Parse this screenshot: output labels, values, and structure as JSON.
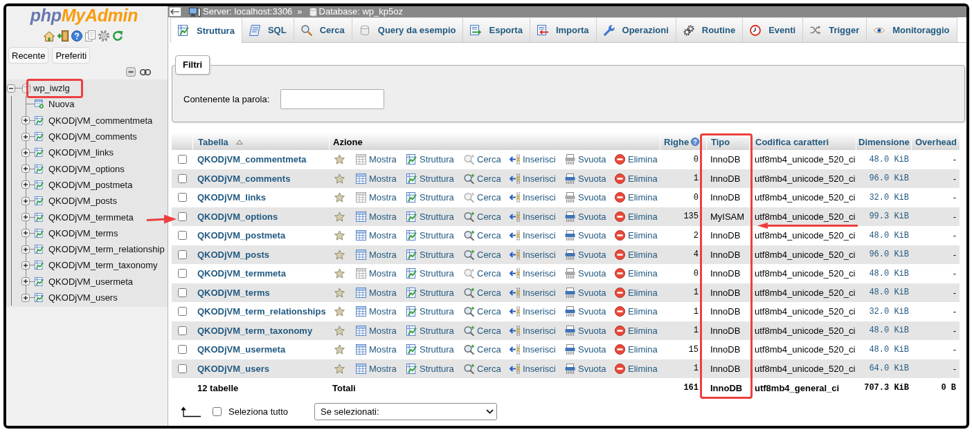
{
  "navigation": {
    "logo": {
      "parts": [
        "php",
        "MyAdmin"
      ]
    },
    "buttons": [
      "Recente",
      "Preferiti"
    ],
    "tree": [
      {
        "label": "wp_iwzlg",
        "kind": "database",
        "expanded": true,
        "children": [
          {
            "label": "Nuova",
            "kind": "new"
          },
          {
            "label": "QKODjVM_commentmeta",
            "kind": "table",
            "expanded": false
          },
          {
            "label": "QKODjVM_comments",
            "kind": "table",
            "expanded": false
          },
          {
            "label": "QKODjVM_links",
            "kind": "table",
            "expanded": false
          },
          {
            "label": "QKODjVM_options",
            "kind": "table",
            "expanded": false
          },
          {
            "label": "QKODjVM_postmeta",
            "kind": "table",
            "expanded": false
          },
          {
            "label": "QKODjVM_posts",
            "kind": "table",
            "expanded": false
          },
          {
            "label": "QKODjVM_termmeta",
            "kind": "table",
            "expanded": false
          },
          {
            "label": "QKODjVM_terms",
            "kind": "table",
            "expanded": false
          },
          {
            "label": "QKODjVM_term_relationship",
            "kind": "table",
            "expanded": false
          },
          {
            "label": "QKODjVM_term_taxonomy",
            "kind": "table",
            "expanded": false
          },
          {
            "label": "QKODjVM_usermeta",
            "kind": "table",
            "expanded": false
          },
          {
            "label": "QKODjVM_users",
            "kind": "table",
            "expanded": false
          }
        ]
      }
    ]
  },
  "breadcrumb": {
    "server": "Server: localhost:3306",
    "separator": "»",
    "database": "Database: wp_kp5oz"
  },
  "tabs": [
    {
      "label": "Struttura",
      "selected": true
    },
    {
      "label": "SQL",
      "selected": false
    },
    {
      "label": "Cerca",
      "selected": false
    },
    {
      "label": "Query da esempio",
      "selected": false
    },
    {
      "label": "Esporta",
      "selected": false
    },
    {
      "label": "Importa",
      "selected": false
    },
    {
      "label": "Operazioni",
      "selected": false
    },
    {
      "label": "Routine",
      "selected": false
    },
    {
      "label": "Eventi",
      "selected": false
    },
    {
      "label": "Trigger",
      "selected": false
    },
    {
      "label": "Monitoraggio",
      "selected": false
    }
  ],
  "filters": {
    "legend": "Filtri",
    "label": "Contenente la parola:"
  },
  "table": {
    "columns": [
      {
        "label": "Tabella",
        "kind": "sorted"
      },
      {
        "label": "Azione",
        "kind": "plain"
      },
      {
        "label": "Righe",
        "kind": "help"
      },
      {
        "label": "Tipo",
        "kind": "link"
      },
      {
        "label": "Codifica caratteri",
        "kind": "link"
      },
      {
        "label": "Dimensione",
        "kind": "link"
      },
      {
        "label": "Overhead",
        "kind": "link"
      }
    ],
    "rows": [
      {
        "checked": false,
        "name": "QKODjVM_commentmeta",
        "favorite": false,
        "empty": true,
        "actions": [
          "Mostra",
          "Struttura",
          "Cerca",
          "Inserisci",
          "Svuota",
          "Elimina"
        ],
        "row_count": "0",
        "type": "InnoDB",
        "collation": "utf8mb4_unicode_520_ci",
        "size": "48.0 KiB",
        "overhead": "-"
      },
      {
        "checked": false,
        "name": "QKODjVM_comments",
        "favorite": false,
        "empty": false,
        "actions": [
          "Mostra",
          "Struttura",
          "Cerca",
          "Inserisci",
          "Svuota",
          "Elimina"
        ],
        "row_count": "1",
        "type": "InnoDB",
        "collation": "utf8mb4_unicode_520_ci",
        "size": "96.0 KiB",
        "overhead": "-"
      },
      {
        "checked": false,
        "name": "QKODjVM_links",
        "favorite": false,
        "empty": true,
        "actions": [
          "Mostra",
          "Struttura",
          "Cerca",
          "Inserisci",
          "Svuota",
          "Elimina"
        ],
        "row_count": "0",
        "type": "InnoDB",
        "collation": "utf8mb4_unicode_520_ci",
        "size": "32.0 KiB",
        "overhead": "-"
      },
      {
        "checked": false,
        "name": "QKODjVM_options",
        "favorite": false,
        "empty": false,
        "actions": [
          "Mostra",
          "Struttura",
          "Cerca",
          "Inserisci",
          "Svuota",
          "Elimina"
        ],
        "row_count": "135",
        "type": "MyISAM",
        "collation": "utf8mb4_unicode_520_ci",
        "size": "99.3 KiB",
        "overhead": "-"
      },
      {
        "checked": false,
        "name": "QKODjVM_postmeta",
        "favorite": false,
        "empty": false,
        "actions": [
          "Mostra",
          "Struttura",
          "Cerca",
          "Inserisci",
          "Svuota",
          "Elimina"
        ],
        "row_count": "2",
        "type": "InnoDB",
        "collation": "utf8mb4_unicode_520_ci",
        "size": "48.0 KiB",
        "overhead": "-"
      },
      {
        "checked": false,
        "name": "QKODjVM_posts",
        "favorite": false,
        "empty": false,
        "actions": [
          "Mostra",
          "Struttura",
          "Cerca",
          "Inserisci",
          "Svuota",
          "Elimina"
        ],
        "row_count": "4",
        "type": "InnoDB",
        "collation": "utf8mb4_unicode_520_ci",
        "size": "96.0 KiB",
        "overhead": "-"
      },
      {
        "checked": false,
        "name": "QKODjVM_termmeta",
        "favorite": false,
        "empty": true,
        "actions": [
          "Mostra",
          "Struttura",
          "Cerca",
          "Inserisci",
          "Svuota",
          "Elimina"
        ],
        "row_count": "0",
        "type": "InnoDB",
        "collation": "utf8mb4_unicode_520_ci",
        "size": "48.0 KiB",
        "overhead": "-"
      },
      {
        "checked": false,
        "name": "QKODjVM_terms",
        "favorite": false,
        "empty": false,
        "actions": [
          "Mostra",
          "Struttura",
          "Cerca",
          "Inserisci",
          "Svuota",
          "Elimina"
        ],
        "row_count": "1",
        "type": "InnoDB",
        "collation": "utf8mb4_unicode_520_ci",
        "size": "48.0 KiB",
        "overhead": "-"
      },
      {
        "checked": false,
        "name": "QKODjVM_term_relationships",
        "favorite": false,
        "empty": false,
        "actions": [
          "Mostra",
          "Struttura",
          "Cerca",
          "Inserisci",
          "Svuota",
          "Elimina"
        ],
        "row_count": "1",
        "type": "InnoDB",
        "collation": "utf8mb4_unicode_520_ci",
        "size": "32.0 KiB",
        "overhead": "-"
      },
      {
        "checked": false,
        "name": "QKODjVM_term_taxonomy",
        "favorite": false,
        "empty": false,
        "actions": [
          "Mostra",
          "Struttura",
          "Cerca",
          "Inserisci",
          "Svuota",
          "Elimina"
        ],
        "row_count": "1",
        "type": "InnoDB",
        "collation": "utf8mb4_unicode_520_ci",
        "size": "48.0 KiB",
        "overhead": "-"
      },
      {
        "checked": false,
        "name": "QKODjVM_usermeta",
        "favorite": false,
        "empty": false,
        "actions": [
          "Mostra",
          "Struttura",
          "Cerca",
          "Inserisci",
          "Svuota",
          "Elimina"
        ],
        "row_count": "15",
        "type": "InnoDB",
        "collation": "utf8mb4_unicode_520_ci",
        "size": "48.0 KiB",
        "overhead": "-"
      },
      {
        "checked": false,
        "name": "QKODjVM_users",
        "favorite": false,
        "empty": false,
        "actions": [
          "Mostra",
          "Struttura",
          "Cerca",
          "Inserisci",
          "Svuota",
          "Elimina"
        ],
        "row_count": "1",
        "type": "InnoDB",
        "collation": "utf8mb4_unicode_520_ci",
        "size": "64.0 KiB",
        "overhead": "-"
      }
    ],
    "footer": {
      "label": "12 tabelle",
      "action": "Totali",
      "row_count": "161",
      "type": "InnoDB",
      "collation": "utf8mb4_general_ci",
      "size": "707.3 KiB",
      "overhead": "0 B"
    }
  },
  "bulk": {
    "select_all": {
      "label": "Seleziona tutto",
      "checked": false
    },
    "with_selected": {
      "value": "Se selezionati:"
    }
  }
}
